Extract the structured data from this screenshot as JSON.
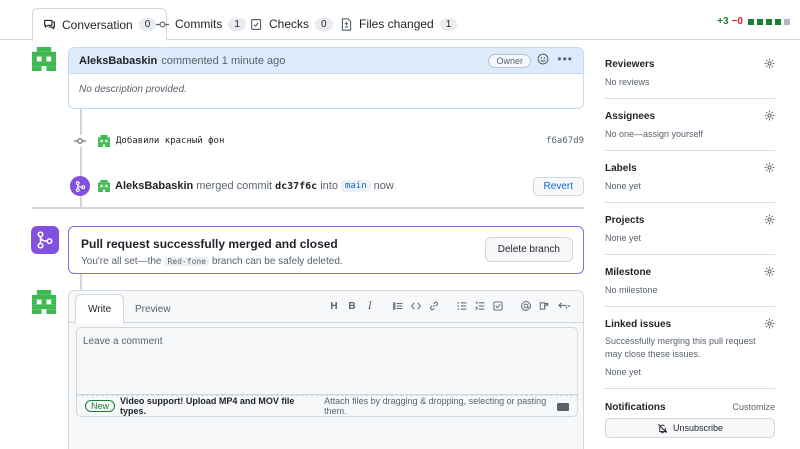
{
  "tabs": [
    {
      "label": "Conversation",
      "count": "0",
      "icon": "conversation-icon"
    },
    {
      "label": "Commits",
      "count": "1",
      "icon": "commit-icon"
    },
    {
      "label": "Checks",
      "count": "0",
      "icon": "checklist-icon"
    },
    {
      "label": "Files changed",
      "count": "1",
      "icon": "file-diff-icon"
    }
  ],
  "diffstat": {
    "additions": "+3",
    "deletions": "−0"
  },
  "comment": {
    "author": "AleksBabaskin",
    "action": "commented 1 minute ago",
    "role": "Owner",
    "body": "No description provided."
  },
  "commit": {
    "message": "Добавили красный фон",
    "sha": "f6a67d9"
  },
  "merge_event": {
    "author": "AleksBabaskin",
    "text_merged": "merged commit",
    "commit": "dc37f6c",
    "text_into": "into",
    "branch": "main",
    "text_time": "now",
    "revert_label": "Revert"
  },
  "merged_box": {
    "title": "Pull request successfully merged and closed",
    "sub_before": "You're all set—the",
    "branch": "Red-fone",
    "sub_after": "branch can be safely deleted.",
    "delete_label": "Delete branch"
  },
  "editor": {
    "write_label": "Write",
    "preview_label": "Preview",
    "placeholder": "Leave a comment",
    "new_badge": "New",
    "upload_bold": "Video support! Upload MP4 and MOV file types.",
    "upload_rest": "Attach files by dragging & dropping, selecting or pasting them."
  },
  "sidebar": {
    "reviewers": {
      "title": "Reviewers",
      "value": "No reviews"
    },
    "assignees": {
      "title": "Assignees",
      "value": "No one—assign yourself"
    },
    "labels": {
      "title": "Labels",
      "value": "None yet"
    },
    "projects": {
      "title": "Projects",
      "value": "None yet"
    },
    "milestone": {
      "title": "Milestone",
      "value": "No milestone"
    },
    "linked_issues": {
      "title": "Linked issues",
      "value": "Successfully merging this pull request may close these issues.",
      "value2": "None yet"
    },
    "notifications": {
      "title": "Notifications",
      "customize": "Customize",
      "unsubscribe": "Unsubscribe"
    }
  },
  "colors": {
    "accent": "#0969da",
    "merged": "#8250df",
    "success": "#1a7f37",
    "danger": "#cf222e"
  }
}
